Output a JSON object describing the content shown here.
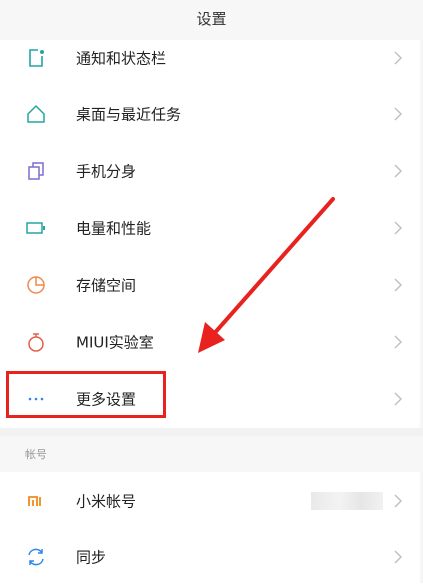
{
  "header": {
    "title": "设置"
  },
  "items": [
    {
      "label": "通知和状态栏",
      "icon": "notification-icon",
      "icon_color": "#22a6a0"
    },
    {
      "label": "桌面与最近任务",
      "icon": "home-icon",
      "icon_color": "#22a6a0"
    },
    {
      "label": "手机分身",
      "icon": "phone-clone-icon",
      "icon_color": "#7b6fd0"
    },
    {
      "label": "电量和性能",
      "icon": "battery-icon",
      "icon_color": "#22a6a0"
    },
    {
      "label": "存储空间",
      "icon": "storage-pie-icon",
      "icon_color": "#f0894b"
    },
    {
      "label": "MIUI实验室",
      "icon": "lab-flask-icon",
      "icon_color": "#e2604b"
    },
    {
      "label": "更多设置",
      "icon": "more-dots-icon",
      "icon_color": "#2d86e8"
    }
  ],
  "account_section": {
    "title": "帐号",
    "items": [
      {
        "label": "小米帐号",
        "icon": "mi-logo-icon",
        "icon_color": "#f08a1d"
      },
      {
        "label": "同步",
        "icon": "sync-icon",
        "icon_color": "#2d86e8"
      }
    ]
  },
  "annotation": {
    "highlight_color": "#e8231f",
    "arrow_color": "#e8231f"
  }
}
